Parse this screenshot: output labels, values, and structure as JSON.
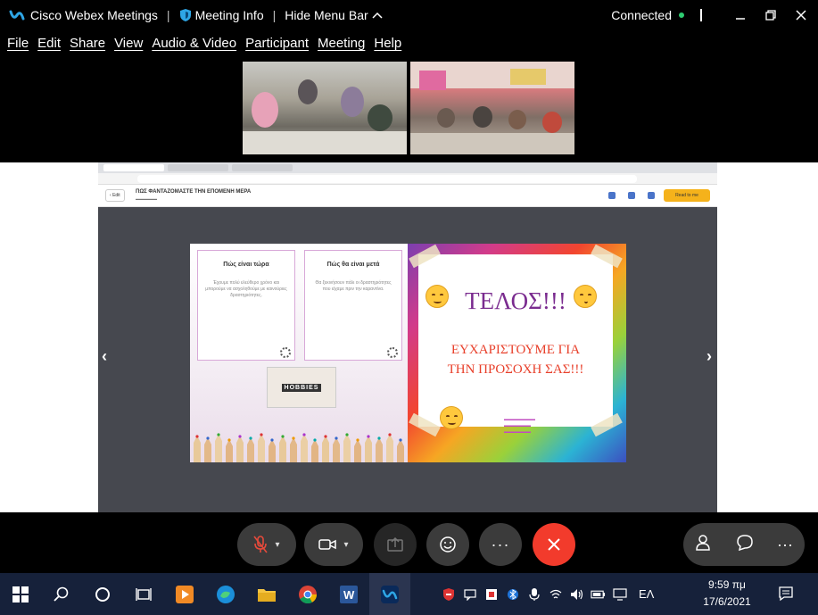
{
  "titlebar": {
    "app_name": "Cisco Webex Meetings",
    "separator": "|",
    "meeting_info": "Meeting Info",
    "hide_menu": "Hide Menu Bar",
    "status": "Connected",
    "status_color": "#2ecc71"
  },
  "menu": {
    "items": [
      "File",
      "Edit",
      "Share",
      "View",
      "Audio & Video",
      "Participant",
      "Meeting",
      "Help"
    ]
  },
  "book": {
    "edit_label": "Edit",
    "title": "ΠΩΣ ΦΑΝΤΑΖΟΜΑΣΤΕ ΤΗΝ ΕΠΟΜΕΝΗ ΜΕΡΑ",
    "read_button": "Read to me",
    "card_left": {
      "title": "Πώς είναι τώρα",
      "body": "Έχουμε πολύ ελεύθερο χρόνο και μπορούμε να ασχοληθούμε με καινούριες δραστηριότητες."
    },
    "card_right": {
      "title": "Πώς θα είναι μετά",
      "body": "Θα ξεκινήσουν πάλι οι δραστηριότητες που είχαμε πριν την καραντίνα."
    },
    "hobbies_label": "HOBBIES",
    "telos": "ΤΕΛΟΣ!!!",
    "thanks_line1": "ΕΥΧΑΡΙΣΤΟΥΜΕ ΓΙΑ",
    "thanks_line2": "ΤΗΝ ΠΡΟΣΟΧΗ ΣΑΣ!!!",
    "accent_purple": "#7a2b8f",
    "accent_red": "#e8402b"
  },
  "taskbar": {
    "language": "ΕΛ",
    "time": "9:59 πμ",
    "date": "17/6/2021"
  }
}
